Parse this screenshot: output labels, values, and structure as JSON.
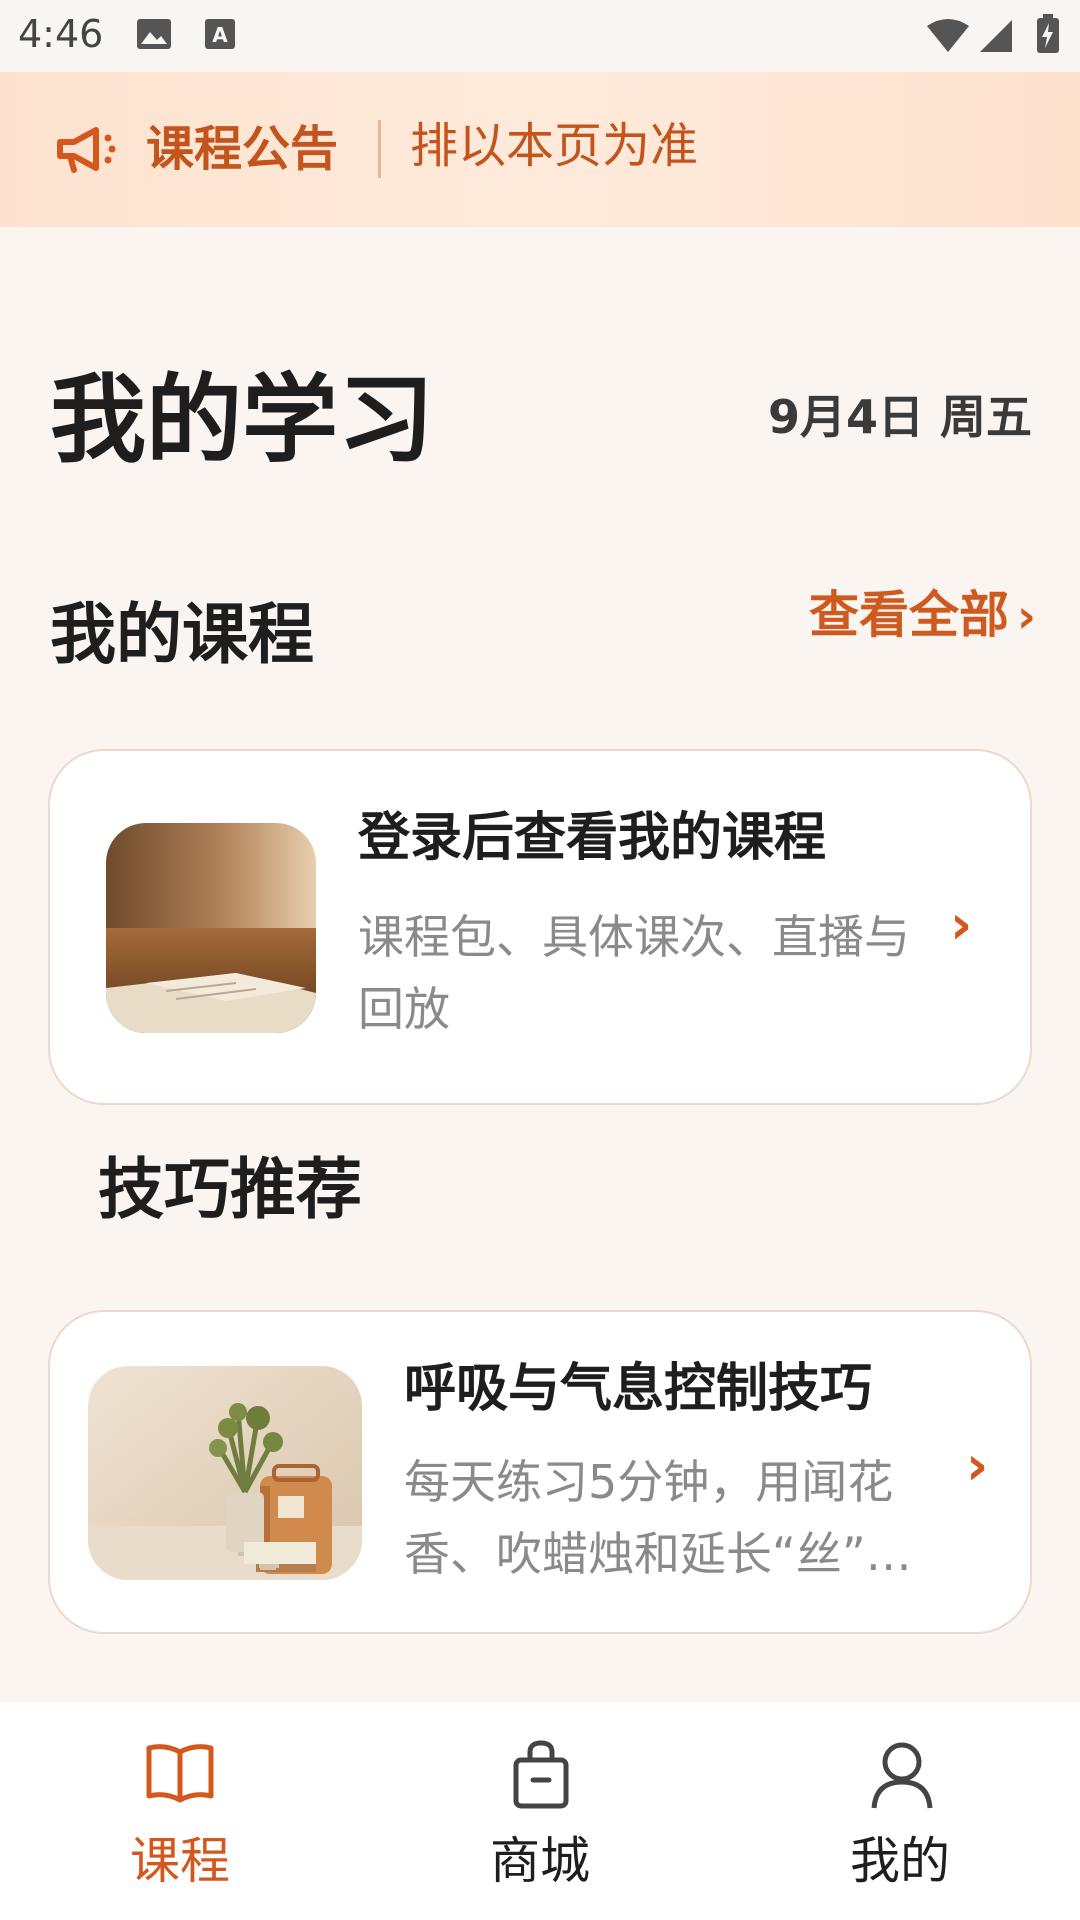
{
  "status_bar": {
    "time": "4:46",
    "icons": [
      "image-icon",
      "text-a-icon",
      "wifi-icon",
      "signal-icon",
      "battery-charging-icon"
    ]
  },
  "announcement": {
    "icon": "megaphone-icon",
    "title": "课程公告",
    "text": "排以本页为准"
  },
  "header": {
    "title": "我的学习",
    "date": "9月4日 周五"
  },
  "my_courses": {
    "section_title": "我的课程",
    "view_all_label": "查看全部",
    "card": {
      "title": "登录后查看我的课程",
      "description": "课程包、具体课次、直播与回放"
    }
  },
  "tips": {
    "section_title": "技巧推荐",
    "card": {
      "title": "呼吸与气息控制技巧",
      "description": "每天练习5分钟，用闻花香、吹蜡烛和延长“丝”…"
    }
  },
  "bottom_nav": {
    "items": [
      {
        "label": "课程",
        "icon": "book-icon",
        "active": true
      },
      {
        "label": "商城",
        "icon": "shopping-bag-icon",
        "active": false
      },
      {
        "label": "我的",
        "icon": "person-icon",
        "active": false
      }
    ]
  },
  "colors": {
    "accent": "#d4581e",
    "banner_bg": "#fde5d2",
    "page_bg": "#fbf5f1"
  }
}
